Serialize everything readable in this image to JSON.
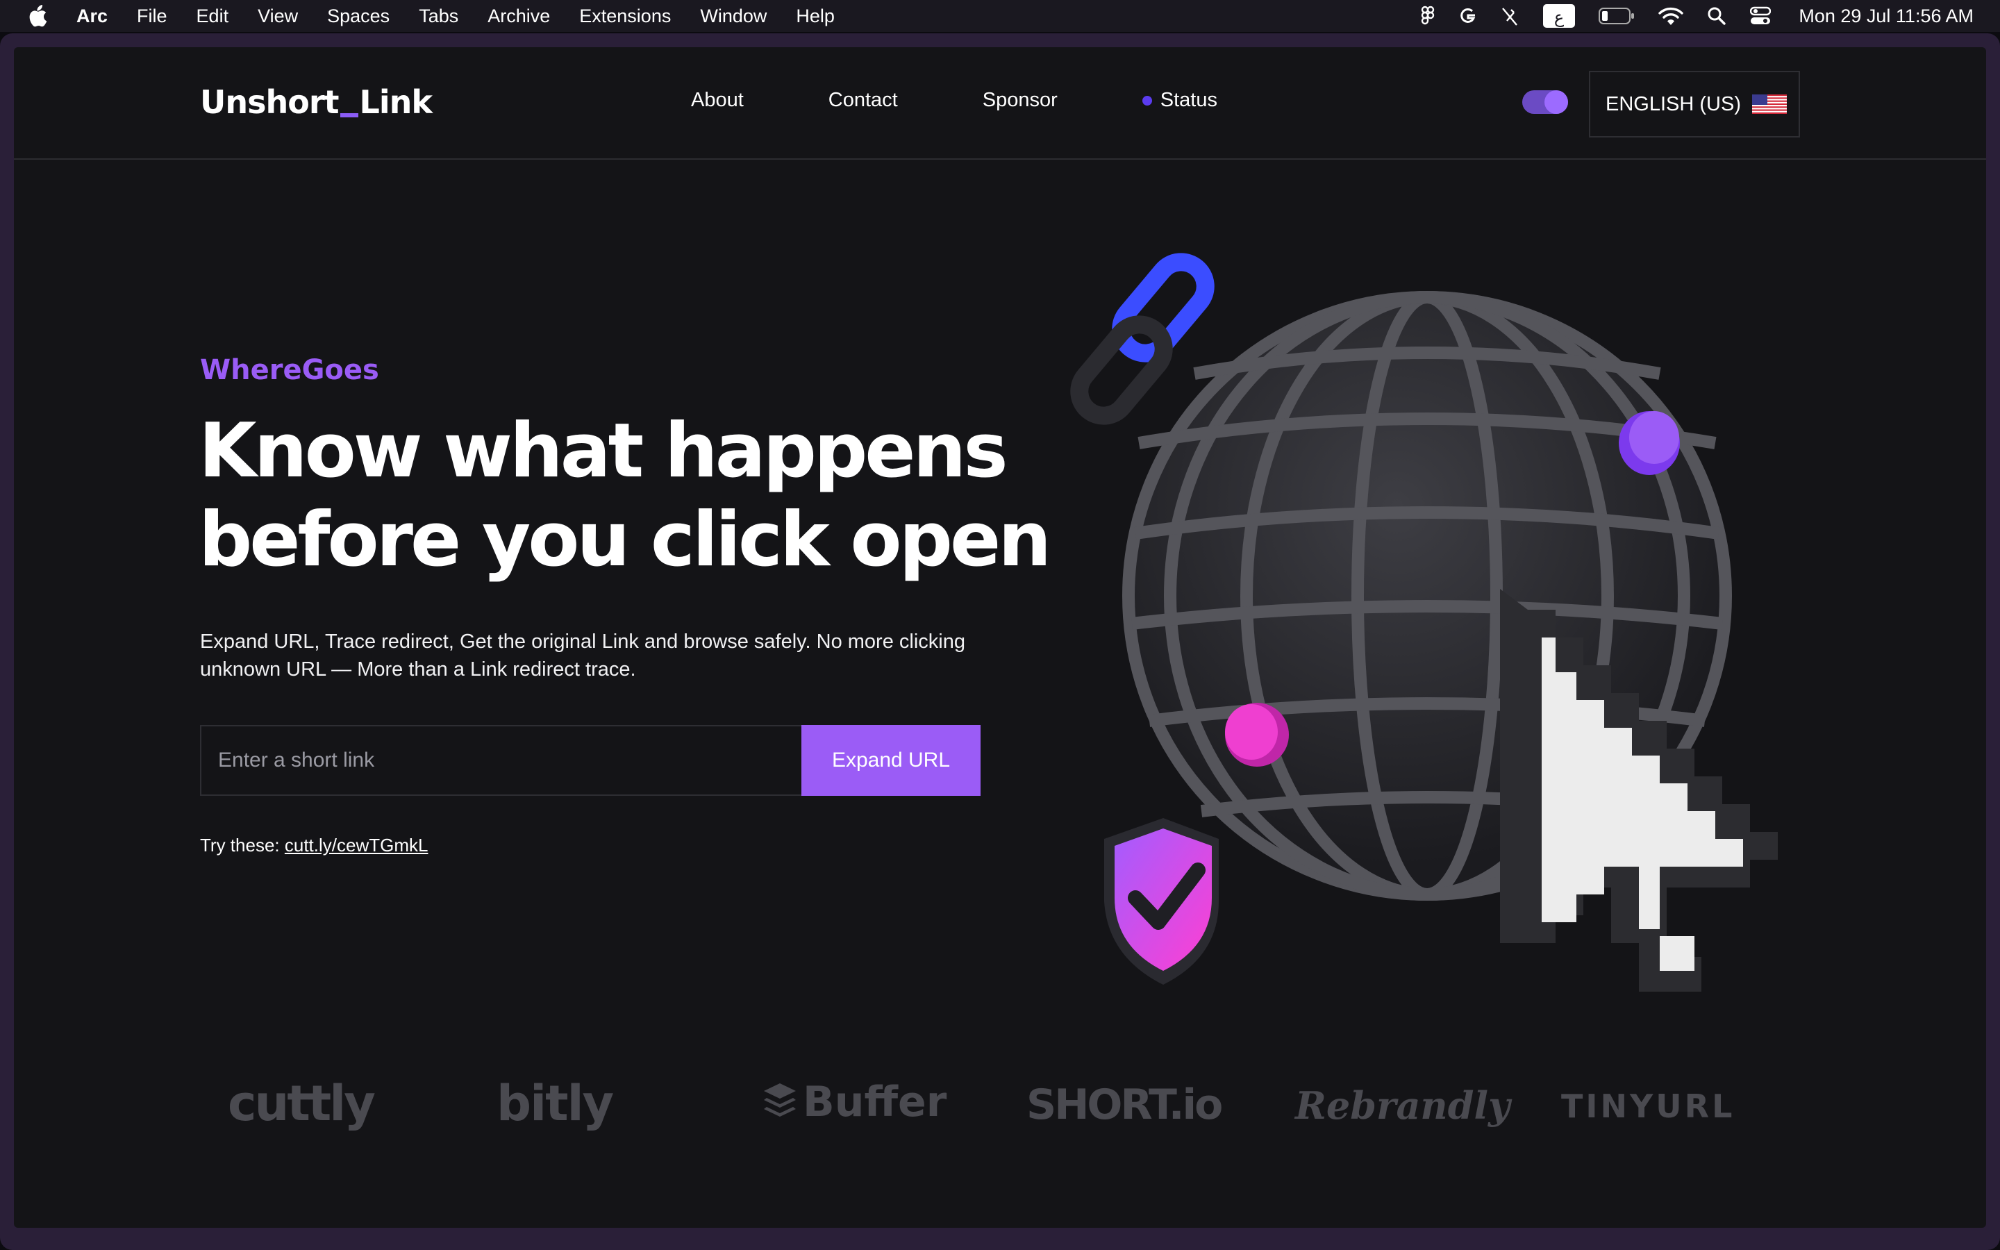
{
  "menubar": {
    "app_name": "Arc",
    "items": [
      "File",
      "Edit",
      "View",
      "Spaces",
      "Tabs",
      "Archive",
      "Extensions",
      "Window",
      "Help"
    ],
    "clock": "Mon 29 Jul  11:56 AM",
    "status_icons": [
      "figma-icon",
      "grammarly-icon",
      "mic-off-icon",
      "keyboard-layout-icon",
      "battery-icon",
      "wifi-icon",
      "spotlight-search-icon",
      "control-center-icon"
    ],
    "keyboard_layout_glyph": "ع"
  },
  "site": {
    "logo_left": "Unshort",
    "logo_right": "Link",
    "nav": {
      "about": "About",
      "contact": "Contact",
      "sponsor": "Sponsor",
      "status": "Status"
    },
    "language": "ENGLISH (US)",
    "accent_color": "#9b5cf6"
  },
  "hero": {
    "eyebrow": "WhereGoes",
    "headline_line1": "Know what happens",
    "headline_line2": "before you click open",
    "description": "Expand URL, Trace redirect, Get the original Link and browse safely. No more clicking unknown URL — More than a Link redirect trace.",
    "input_placeholder": "Enter a short link",
    "button_label": "Expand URL",
    "try_label": "Try these:",
    "try_link": "cutt.ly/cewTGmkL"
  },
  "brands": [
    "cuttly",
    "bitly",
    "Buffer",
    "SHORT.io",
    "Rebrandly",
    "TINYURL"
  ]
}
